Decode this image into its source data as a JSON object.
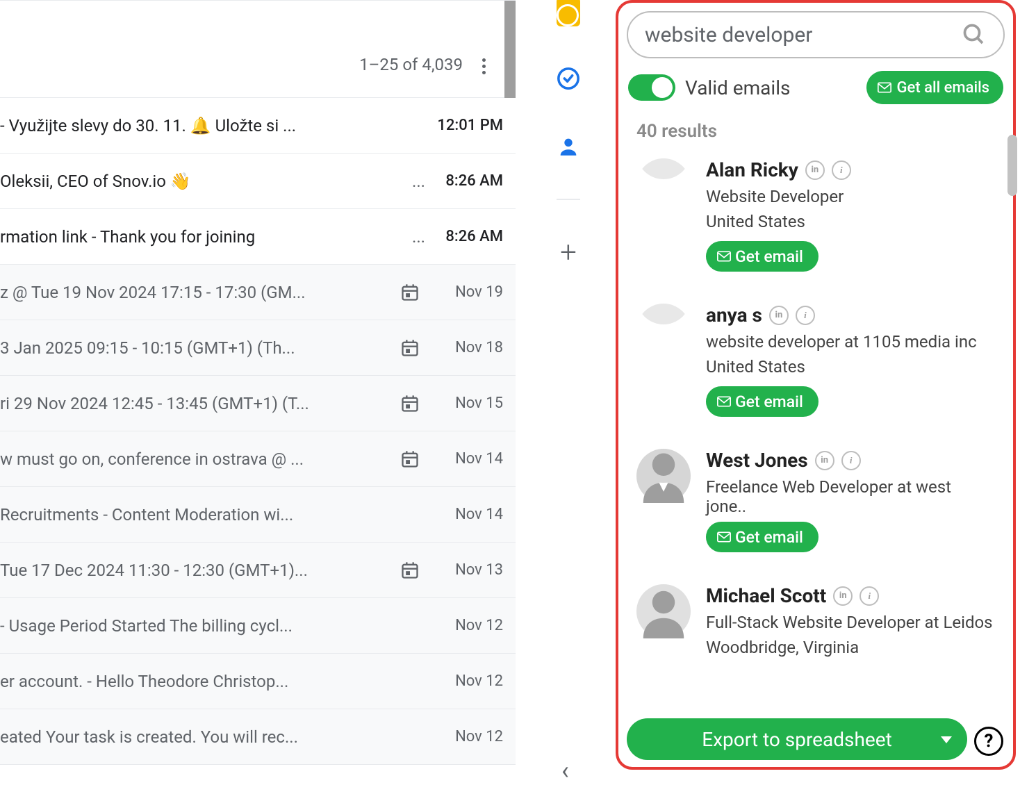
{
  "inbox": {
    "pagination": "1–25 of 4,039",
    "rows": [
      {
        "subject": " - Využijte slevy do 30. 11. 🔔 Uložte si ...",
        "time": "12:01 PM",
        "hasCalendar": false,
        "hasEllipsis": false,
        "unread": true
      },
      {
        "subject": "Oleksii, CEO of Snov.io 👋",
        "time": "8:26 AM",
        "hasCalendar": false,
        "hasEllipsis": true,
        "unread": true
      },
      {
        "subject": "rmation link - Thank you for joining",
        "time": "8:26 AM",
        "hasCalendar": false,
        "hasEllipsis": true,
        "unread": true
      },
      {
        "subject": "z @ Tue 19 Nov 2024 17:15 - 17:30 (GM...",
        "time": "Nov 19",
        "hasCalendar": true,
        "hasEllipsis": false,
        "unread": false
      },
      {
        "subject": " 3 Jan 2025 09:15 - 10:15 (GMT+1) (Th...",
        "time": "Nov 18",
        "hasCalendar": true,
        "hasEllipsis": false,
        "unread": false
      },
      {
        "subject": "ri 29 Nov 2024 12:45 - 13:45 (GMT+1) (T...",
        "time": "Nov 15",
        "hasCalendar": true,
        "hasEllipsis": false,
        "unread": false
      },
      {
        "subject": "w must go on, conference in ostrava @ ...",
        "time": "Nov 14",
        "hasCalendar": true,
        "hasEllipsis": false,
        "unread": false
      },
      {
        "subject": "Recruitments - Content Moderation wi...",
        "time": "Nov 14",
        "hasCalendar": false,
        "hasEllipsis": false,
        "unread": false
      },
      {
        "subject": " Tue 17 Dec 2024 11:30 - 12:30 (GMT+1)...",
        "time": "Nov 13",
        "hasCalendar": true,
        "hasEllipsis": false,
        "unread": false
      },
      {
        "subject": " - Usage Period Started The billing cycl...",
        "time": "Nov 12",
        "hasCalendar": false,
        "hasEllipsis": false,
        "unread": false
      },
      {
        "subject": "er account. - Hello Theodore Christop...",
        "time": "Nov 12",
        "hasCalendar": false,
        "hasEllipsis": false,
        "unread": false
      },
      {
        "subject": "eated Your task is created. You will rec...",
        "time": "Nov 12",
        "hasCalendar": false,
        "hasEllipsis": false,
        "unread": false
      }
    ]
  },
  "extension": {
    "searchQuery": "website developer",
    "toggleLabel": "Valid emails",
    "getAllLabel": "Get all emails",
    "resultsCount": "40 results",
    "getEmailLabel": "Get email",
    "exportLabel": "Export to spreadsheet",
    "linkedinBadge": "in",
    "infoBadge": "i",
    "results": [
      {
        "name": "Alan Ricky",
        "role": "Website Developer",
        "location": "United States",
        "avatar": "partial",
        "showBtn": true
      },
      {
        "name": "anya s",
        "role": "website developer at 1105 media inc",
        "location": "United States",
        "avatar": "partial",
        "showBtn": true
      },
      {
        "name": "West Jones",
        "role": "Freelance Web Developer at west jone..",
        "location": "",
        "avatar": "suit",
        "showBtn": true
      },
      {
        "name": "Michael Scott",
        "role": "Full-Stack Website Developer at Leidos",
        "location": "Woodbridge, Virginia",
        "avatar": "plain",
        "showBtn": false
      }
    ]
  }
}
